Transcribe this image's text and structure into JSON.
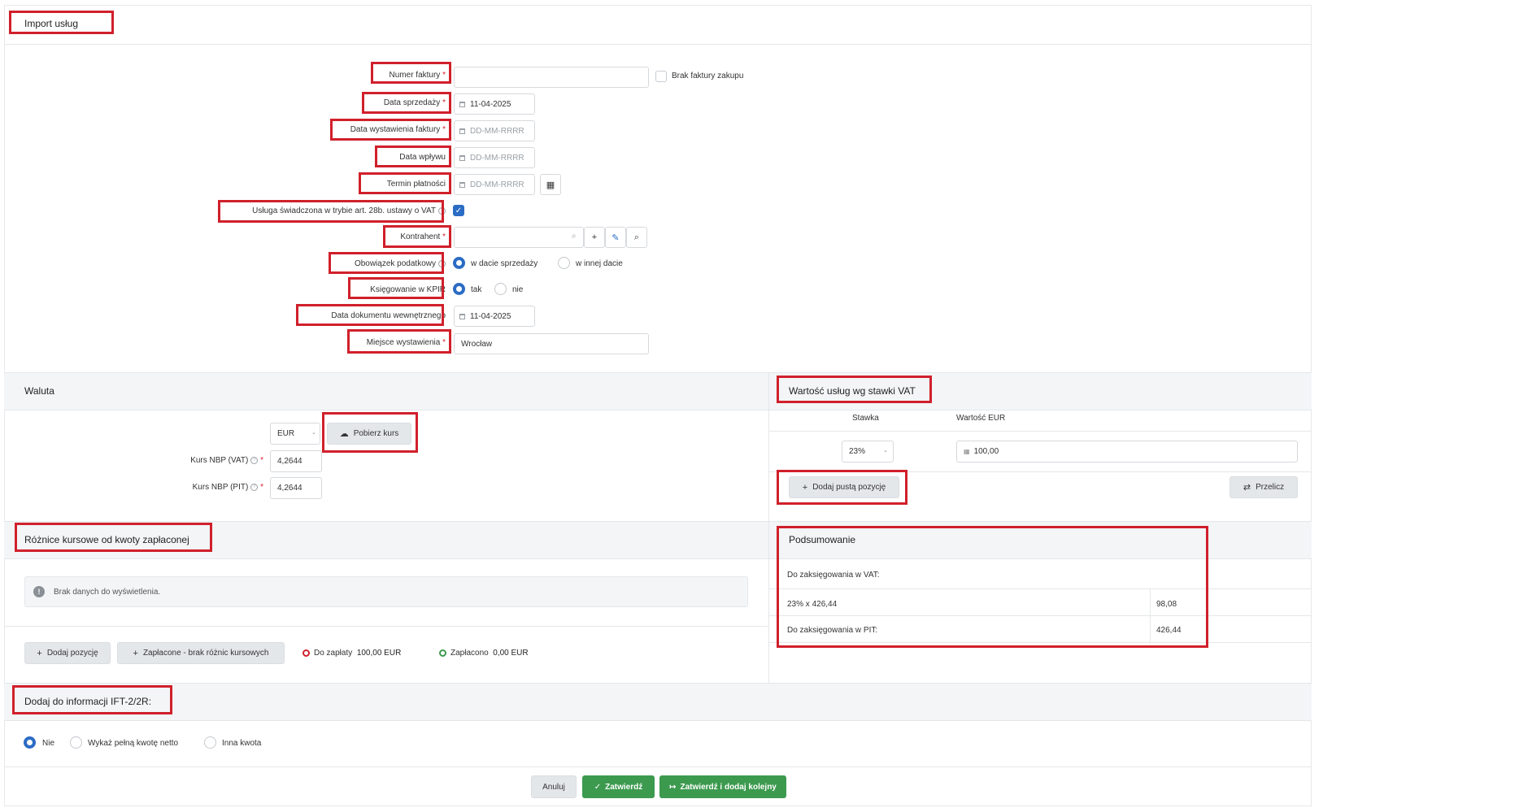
{
  "header": {
    "title": "Import usług"
  },
  "form": {
    "invoice_number": {
      "label": "Numer faktury",
      "required": "*",
      "value": ""
    },
    "no_invoice": {
      "label": "Brak faktury zakupu"
    },
    "sale_date": {
      "label": "Data sprzedaży",
      "required": "*",
      "value": "11-04-2025"
    },
    "issue_date": {
      "label": "Data wystawienia faktury",
      "required": "*",
      "placeholder": "DD-MM-RRRR"
    },
    "receipt_date": {
      "label": "Data wpływu",
      "placeholder": "DD-MM-RRRR"
    },
    "payment_term": {
      "label": "Termin płatności",
      "placeholder": "DD-MM-RRRR"
    },
    "art28b": {
      "label": "Usługa świadczona w trybie art. 28b. ustawy o VAT"
    },
    "contractor": {
      "label": "Kontrahent",
      "required": "*",
      "value": ""
    },
    "tax_obligation": {
      "label": "Obowiązek podatkowy",
      "opt1": "w dacie sprzedaży",
      "opt2": "w innej dacie"
    },
    "kpir": {
      "label": "Księgowanie w KPIR",
      "opt1": "tak",
      "opt2": "nie"
    },
    "internal_doc_date": {
      "label": "Data dokumentu wewnętrznego",
      "value": "11-04-2025"
    },
    "issue_place": {
      "label": "Miejsce wystawienia",
      "required": "*",
      "value": "Wrocław"
    }
  },
  "currency": {
    "title": "Waluta",
    "selected": "EUR",
    "fetch_button": "Pobierz kurs",
    "nbp_vat": {
      "label": "Kurs NBP (VAT)",
      "required": "*",
      "value": "4,2644"
    },
    "nbp_pit": {
      "label": "Kurs NBP (PIT)",
      "required": "*",
      "value": "4,2644"
    }
  },
  "vat_values": {
    "title": "Wartość usług wg stawki VAT",
    "col_rate": "Stawka",
    "col_value": "Wartość EUR",
    "rate": "23%",
    "value": "100,00",
    "add_empty": "Dodaj pustą pozycję",
    "recalc": "Przelicz"
  },
  "fx_diff": {
    "title": "Różnice kursowe od kwoty zapłaconej",
    "empty": "Brak danych do wyświetlenia.",
    "add_item": "Dodaj pozycję",
    "paid_no_diff": "Zapłacone - brak różnic kursowych",
    "to_pay_label": "Do zapłaty",
    "to_pay_value": "100,00 EUR",
    "paid_label": "Zapłacono",
    "paid_value": "0,00 EUR"
  },
  "summary": {
    "title": "Podsumowanie",
    "vat_heading": "Do zaksięgowania w VAT:",
    "vat_row_label": "23% x 426,44",
    "vat_row_value": "98,08",
    "pit_label": "Do zaksięgowania w PIT:",
    "pit_value": "426,44"
  },
  "ift": {
    "title": "Dodaj do informacji IFT-2/2R:",
    "opt1": "Nie",
    "opt2": "Wykaż pełną kwotę netto",
    "opt3": "Inna kwota"
  },
  "footer": {
    "cancel": "Anuluj",
    "confirm": "Zatwierdź",
    "confirm_next": "Zatwierdź i dodaj kolejny"
  },
  "colors": {
    "accent": "#2b6cc4",
    "success": "#3c9a4f",
    "highlight": "#d0202b"
  }
}
